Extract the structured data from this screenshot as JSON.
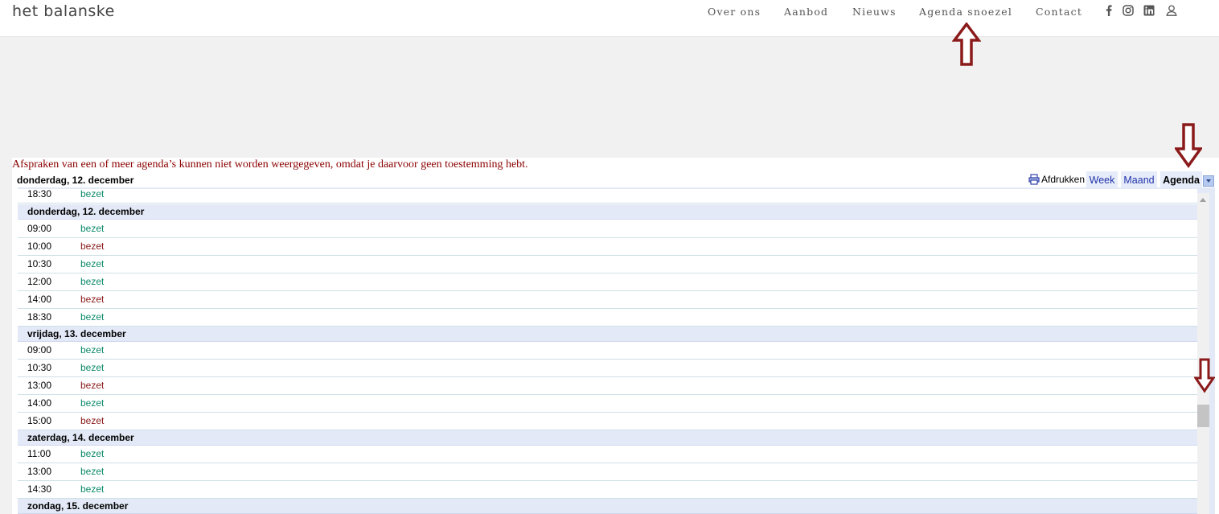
{
  "site": {
    "logo": "het balanske"
  },
  "nav": {
    "items": [
      {
        "label": "Over ons"
      },
      {
        "label": "Aanbod"
      },
      {
        "label": "Nieuws"
      },
      {
        "label": "Agenda snoezel"
      },
      {
        "label": "Contact"
      }
    ],
    "icons": [
      "facebook-icon",
      "instagram-icon",
      "linkedin-icon",
      "user-icon"
    ]
  },
  "calendar": {
    "warning": "Afspraken van een of meer agenda’s kunnen niet worden weergegeven, omdat je daarvoor geen toestemming hebt.",
    "header_date": "donderdag, 12. december",
    "print_label": "Afdrukken",
    "tabs": [
      {
        "label": "Week"
      },
      {
        "label": "Maand"
      },
      {
        "label": "Agenda"
      }
    ],
    "partial_row": {
      "time": "18:30",
      "event": "bezet",
      "color": "green"
    },
    "days": [
      {
        "label": "donderdag, 12. december",
        "events": [
          {
            "time": "09:00",
            "event": "bezet",
            "color": "green"
          },
          {
            "time": "10:00",
            "event": "bezet",
            "color": "red"
          },
          {
            "time": "10:30",
            "event": "bezet",
            "color": "green"
          },
          {
            "time": "12:00",
            "event": "bezet",
            "color": "green"
          },
          {
            "time": "14:00",
            "event": "bezet",
            "color": "red"
          },
          {
            "time": "18:30",
            "event": "bezet",
            "color": "green"
          }
        ]
      },
      {
        "label": "vrijdag, 13. december",
        "events": [
          {
            "time": "09:00",
            "event": "bezet",
            "color": "green"
          },
          {
            "time": "10:30",
            "event": "bezet",
            "color": "green"
          },
          {
            "time": "13:00",
            "event": "bezet",
            "color": "red"
          },
          {
            "time": "14:00",
            "event": "bezet",
            "color": "green"
          },
          {
            "time": "15:00",
            "event": "bezet",
            "color": "red"
          }
        ]
      },
      {
        "label": "zaterdag, 14. december",
        "events": [
          {
            "time": "11:00",
            "event": "bezet",
            "color": "green"
          },
          {
            "time": "13:00",
            "event": "bezet",
            "color": "green"
          },
          {
            "time": "14:30",
            "event": "bezet",
            "color": "green"
          }
        ]
      },
      {
        "label": "zondag, 15. december",
        "events": []
      }
    ]
  },
  "colors": {
    "green": "#0d8a6a",
    "red": "#8b1a1a",
    "warning": "#8b0000",
    "arrow": "#8b1a1a"
  }
}
